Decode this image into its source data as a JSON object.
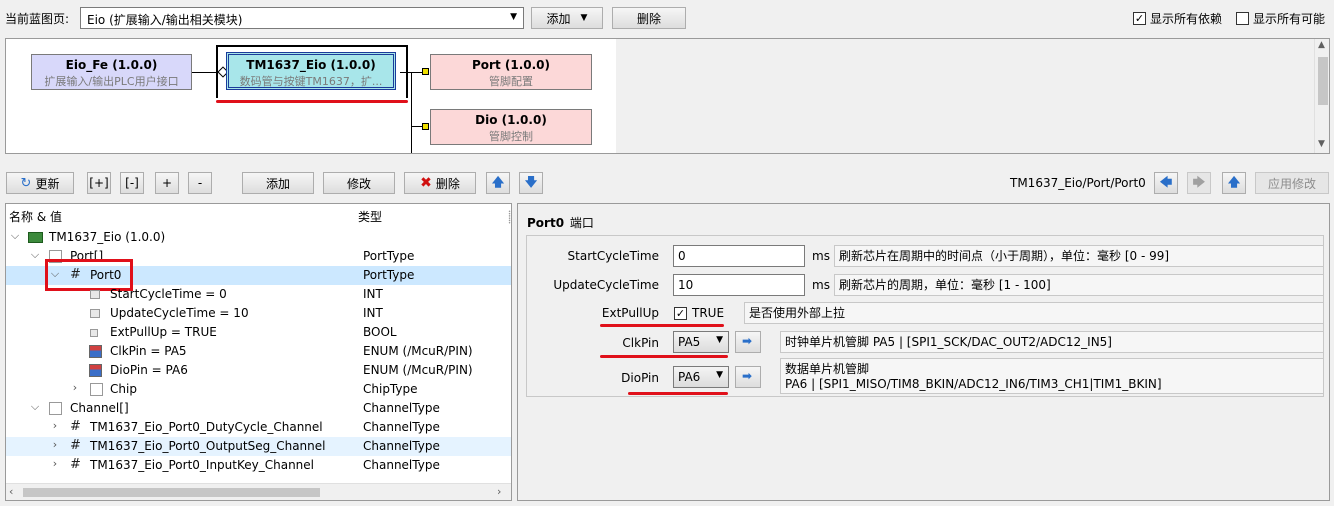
{
  "topbar": {
    "label": "当前蓝图页:",
    "combo_value": "Eio (扩展输入/输出相关模块)",
    "add_label": "添加",
    "delete_label": "删除",
    "show_all_deps": "显示所有依赖",
    "show_all_possible": "显示所有可能"
  },
  "diagram": {
    "nodes": [
      {
        "title": "Eio_Fe (1.0.0)",
        "subtitle": "扩展输入/输出PLC用户接口"
      },
      {
        "title": "TM1637_Eio (1.0.0)",
        "subtitle": "数码管与按键TM1637，扩..."
      },
      {
        "title": "Port (1.0.0)",
        "subtitle": "管脚配置"
      },
      {
        "title": "Dio (1.0.0)",
        "subtitle": "管脚控制"
      }
    ]
  },
  "toolbar": {
    "refresh": "更新",
    "expand_all": "[+]",
    "collapse_all": "[-]",
    "expand": "+",
    "collapse": "-",
    "add": "添加",
    "modify": "修改",
    "delete": "删除",
    "path": "TM1637_Eio/Port/Port0",
    "apply": "应用修改"
  },
  "tree": {
    "col_name": "名称 & 值",
    "col_type": "类型",
    "rows": [
      {
        "name": "TM1637_Eio (1.0.0)",
        "type": ""
      },
      {
        "name": "Port[]",
        "type": "PortType"
      },
      {
        "name": "Port0",
        "type": "PortType"
      },
      {
        "name": "StartCycleTime = 0",
        "type": "INT"
      },
      {
        "name": "UpdateCycleTime = 10",
        "type": "INT"
      },
      {
        "name": "ExtPullUp = TRUE",
        "type": "BOOL"
      },
      {
        "name": "ClkPin = PA5",
        "type": "ENUM (/McuR/PIN)"
      },
      {
        "name": "DioPin = PA6",
        "type": "ENUM (/McuR/PIN)"
      },
      {
        "name": "Chip",
        "type": "ChipType"
      },
      {
        "name": "Channel[]",
        "type": "ChannelType"
      },
      {
        "name": "TM1637_Eio_Port0_DutyCycle_Channel",
        "type": "ChannelType"
      },
      {
        "name": "TM1637_Eio_Port0_OutputSeg_Channel",
        "type": "ChannelType"
      },
      {
        "name": "TM1637_Eio_Port0_InputKey_Channel",
        "type": "ChannelType"
      }
    ]
  },
  "props": {
    "header_name": "Port0",
    "header_suffix": "端口",
    "start_label": "StartCycleTime",
    "start_value": "0",
    "start_unit": "ms",
    "start_desc": "刷新芯片在周期中的时间点（小于周期），单位：毫秒 [0 - 99]",
    "update_label": "UpdateCycleTime",
    "update_value": "10",
    "update_unit": "ms",
    "update_desc": "刷新芯片的周期，单位：毫秒 [1 - 100]",
    "pull_label": "ExtPullUp",
    "pull_value": "TRUE",
    "pull_desc": "是否使用外部上拉",
    "clk_label": "ClkPin",
    "clk_value": "PA5",
    "clk_desc": "时钟单片机管脚 PA5 | [SPI1_SCK/DAC_OUT2/ADC12_IN5]",
    "dio_label": "DioPin",
    "dio_value": "PA6",
    "dio_desc1": "数据单片机管脚",
    "dio_desc2": "PA6 | [SPI1_MISO/TIM8_BKIN/ADC12_IN6/TIM3_CH1|TIM1_BKIN]"
  },
  "colors": {
    "accent_red": "#e0101a",
    "selected_row": "#cce8ff",
    "node_blue": "#d8d8fa",
    "node_cyan": "#a8e6ea",
    "node_pink": "#fcd8d8"
  }
}
